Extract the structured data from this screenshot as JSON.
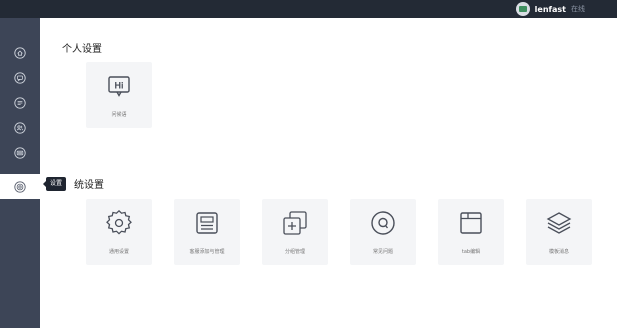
{
  "header": {
    "username": "lenfast",
    "status": "在线"
  },
  "sidebar": {
    "tooltip": "设置",
    "items": [
      {
        "icon": "home-icon"
      },
      {
        "icon": "chat-icon"
      },
      {
        "icon": "message-icon"
      },
      {
        "icon": "user-group-icon"
      },
      {
        "icon": "keyboard-icon"
      },
      {
        "icon": "settings-icon",
        "active": true
      }
    ]
  },
  "personal": {
    "title": "个人设置",
    "cards": [
      {
        "label": "问候语",
        "icon": "greeting-icon"
      }
    ]
  },
  "system": {
    "title": "系统设置",
    "title_visible": "统设置",
    "cards": [
      {
        "label": "通用设置",
        "icon": "gear-icon"
      },
      {
        "label": "客服添加与管理",
        "icon": "id-card-icon"
      },
      {
        "label": "分组管理",
        "icon": "group-add-icon"
      },
      {
        "label": "常见问题",
        "icon": "faq-icon"
      },
      {
        "label": "tab编辑",
        "icon": "tab-window-icon"
      },
      {
        "label": "模板消息",
        "icon": "layers-icon"
      }
    ]
  },
  "colors": {
    "header_bg": "#232a35",
    "sidebar_bg": "#3d4557",
    "card_bg": "#f4f5f7",
    "icon_stroke": "#4a4f5a"
  }
}
